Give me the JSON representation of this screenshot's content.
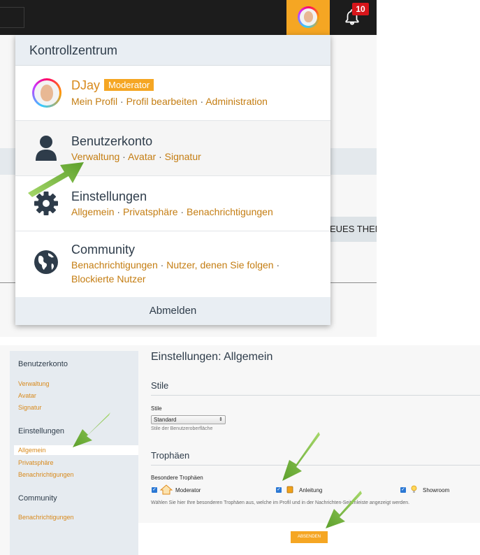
{
  "topbar": {
    "notification_count": "10"
  },
  "background": {
    "new_topic_button": "EUES THEM"
  },
  "panel": {
    "title": "Kontrollzentrum",
    "user": {
      "name": "DJay",
      "role_badge": "Moderator",
      "links": [
        "Mein Profil",
        "Profil bearbeiten",
        "Administration"
      ]
    },
    "account": {
      "title": "Benutzerkonto",
      "links": [
        "Verwaltung",
        "Avatar",
        "Signatur"
      ]
    },
    "settings": {
      "title": "Einstellungen",
      "links": [
        "Allgemein",
        "Privatsphäre",
        "Benachrichtigungen"
      ]
    },
    "community": {
      "title": "Community",
      "links": [
        "Benachrichtigungen",
        "Nutzer, denen Sie folgen",
        "Blockierte Nutzer"
      ]
    },
    "logout": "Abmelden"
  },
  "sidebar": {
    "account_heading": "Benutzerkonto",
    "account_links": [
      "Verwaltung",
      "Avatar",
      "Signatur"
    ],
    "settings_heading": "Einstellungen",
    "settings_links": [
      "Allgemein",
      "Privatsphäre",
      "Benachrichtigungen"
    ],
    "community_heading": "Community",
    "community_links": [
      "Benachrichtigungen"
    ]
  },
  "main": {
    "page_title": "Einstellungen: Allgemein",
    "styles_section": "Stile",
    "style_label": "Stile",
    "style_value": "Standard",
    "style_hint": "Stile der Benutzeroberfläche",
    "trophies_section": "Trophäen",
    "special_trophies_label": "Besondere Trophäen",
    "trophies": [
      "Moderator",
      "Anleitung",
      "Showroom"
    ],
    "trophies_hint": "Wählen Sie hier Ihre besonderen Trophäen aus, welche im Profil und in der Nachrichten-Seitenleiste angezeigt werden.",
    "submit": "ABSENDEN"
  },
  "colors": {
    "accent": "#f5a623",
    "link": "#c47d12",
    "badge": "#d7151a",
    "arrow": "#7dbd3a"
  }
}
